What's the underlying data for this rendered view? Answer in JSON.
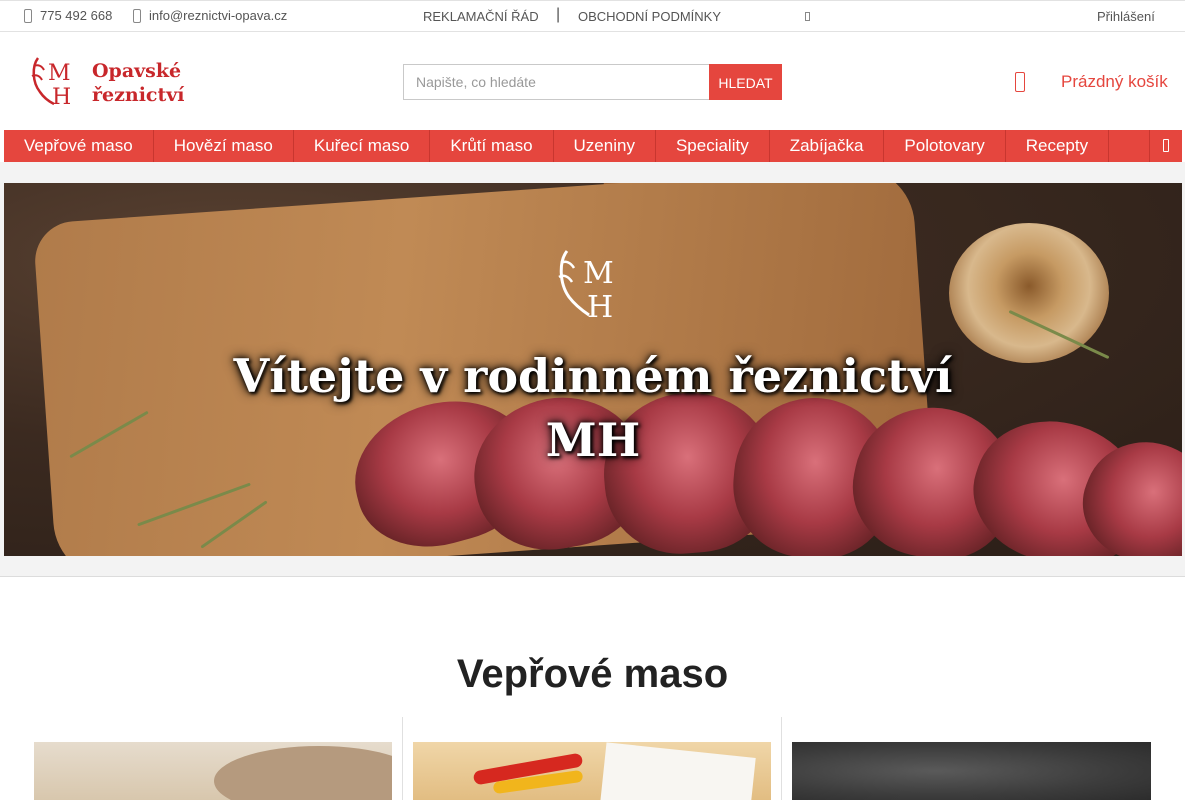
{
  "topbar": {
    "phone": "775 492 668",
    "email": "info@reznictvi-opava.cz",
    "links": [
      "REKLAMAČNÍ ŘÁD",
      "OBCHODNÍ PODMÍNKY"
    ],
    "separator": "|",
    "login": "Přihlášení"
  },
  "header": {
    "logo_line1": "Opavské",
    "logo_line2": "řeznictví",
    "search_placeholder": "Napište, co hledáte",
    "search_button": "HLEDAT",
    "cart_label": "Prázdný košík"
  },
  "nav": {
    "items": [
      "Vepřové maso",
      "Hovězí maso",
      "Kuřecí maso",
      "Krůtí maso",
      "Uzeniny",
      "Speciality",
      "Zabíjačka",
      "Polotovary",
      "Recepty"
    ]
  },
  "hero": {
    "title_line1": "Vítejte v rodinném řeznictví",
    "title_line2": "MH"
  },
  "section": {
    "title": "Vepřové maso"
  },
  "colors": {
    "accent": "#e5463e",
    "logo_red": "#c8272b"
  },
  "icons": [
    "phone-icon",
    "mail-icon",
    "user-icon",
    "cart-icon",
    "chevron-icon"
  ]
}
